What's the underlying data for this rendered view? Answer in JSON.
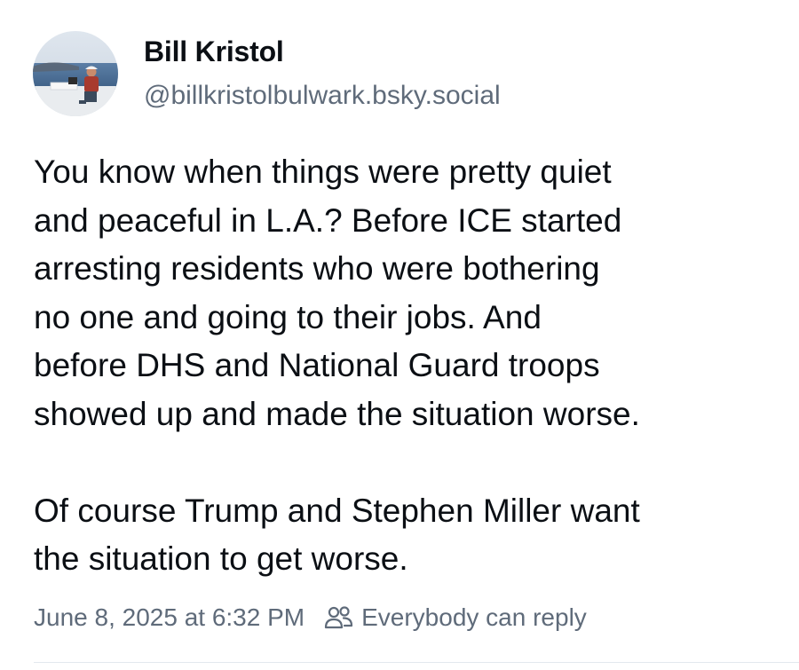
{
  "post": {
    "author_name": "Bill Kristol",
    "author_handle": "@billkristolbulwark.bsky.social",
    "text": "You know when things were pretty quiet\nand peaceful in L.A.? Before ICE started\narresting residents who were bothering\nno one and going to their jobs. And\nbefore DHS and National Guard troops\nshowed up and made the situation worse.\n\nOf course Trump and Stephen Miller want\nthe situation to get worse.",
    "timestamp": "June 8, 2025 at 6:32 PM",
    "reply_setting": "Everybody can reply",
    "reply_icon": "people-icon"
  },
  "colors": {
    "text_primary": "#0b0f14",
    "text_secondary": "#5f6b7a",
    "divider": "#e3e8ee"
  }
}
